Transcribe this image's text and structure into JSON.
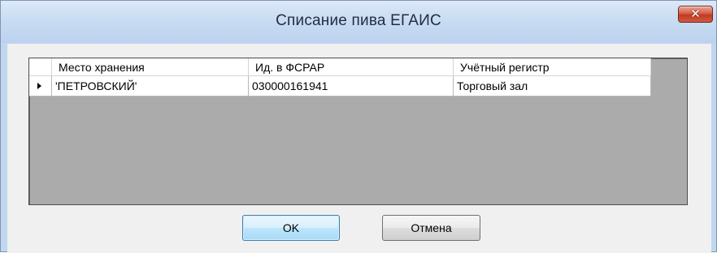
{
  "window": {
    "title": "Списание пива ЕГАИС",
    "close_icon": "close-icon"
  },
  "grid": {
    "columns": [
      "Место хранения",
      "Ид. в ФСРАР",
      "Учётный регистр"
    ],
    "rows": [
      {
        "current": true,
        "cells": [
          "'ПЕТРОВСКИЙ'",
          "030000161941",
          "Торговый зал"
        ]
      }
    ]
  },
  "buttons": {
    "ok_label": "OK",
    "cancel_label": "Отмена"
  },
  "colors": {
    "titlebar": "#c1d6ef",
    "grid_background": "#ababab",
    "close_button": "#c23a22"
  }
}
